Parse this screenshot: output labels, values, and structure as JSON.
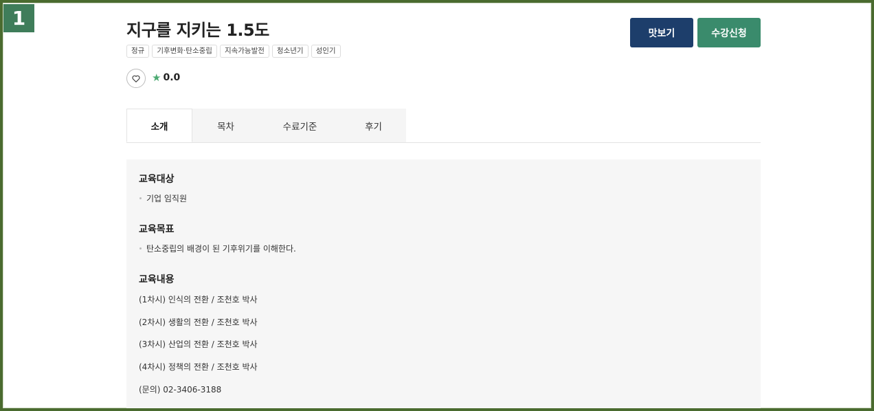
{
  "badge": "1",
  "course": {
    "title": "지구를 지키는 1.5도",
    "tags": [
      "정규",
      "기후변화·탄소중립",
      "지속가능발전",
      "청소년기",
      "성인기"
    ],
    "rating": "0.0"
  },
  "actions": {
    "preview_label": "맛보기",
    "enroll_label": "수강신청"
  },
  "tabs": [
    {
      "label": "소개",
      "active": true
    },
    {
      "label": "목차",
      "active": false
    },
    {
      "label": "수료기준",
      "active": false
    },
    {
      "label": "후기",
      "active": false
    }
  ],
  "intro": {
    "target_title": "교육대상",
    "target_item": "기업 임직원",
    "goal_title": "교육목표",
    "goal_item": "탄소중립의 배경이 된 기후위기를 이해한다.",
    "content_title": "교육내용",
    "content_lines": [
      "(1차시) 인식의 전환 / 조천호 박사",
      "(2차시) 생활의 전환 / 조천호 박사",
      "(3차시) 산업의 전환 / 조천호 박사",
      "(4차시) 정책의 전환 / 조천호 박사",
      "(문의) 02-3406-3188"
    ]
  },
  "colors": {
    "frame": "#4a6b2f",
    "badge": "#3f7d5a",
    "preview_button": "#1d3e6b",
    "enroll_button": "#3a8b6c",
    "star": "#4caa72"
  },
  "icons": {
    "like": "heart-icon",
    "rating": "star-icon"
  }
}
